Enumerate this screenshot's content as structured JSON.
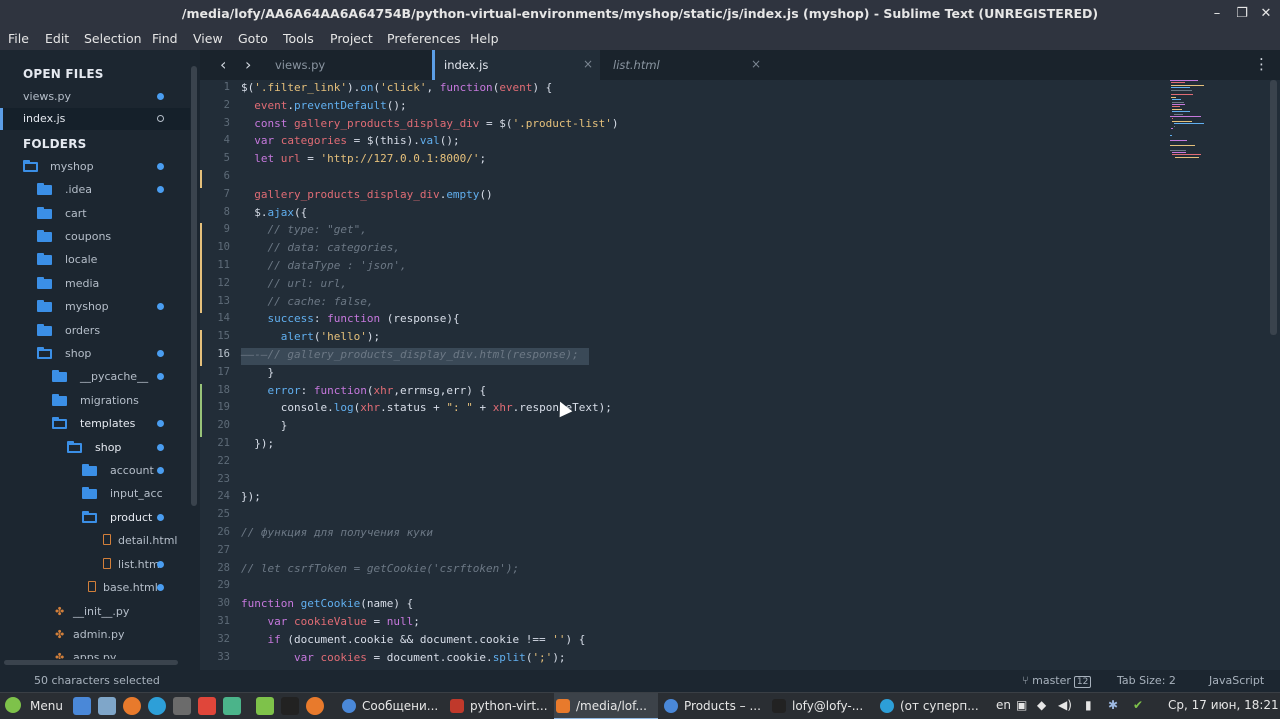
{
  "window": {
    "title": "/media/lofy/AA6A64AA6A64754B/python-virtual-environments/myshop/static/js/index.js (myshop) - Sublime Text (UNREGISTERED)",
    "minimize": "–",
    "maximize": "❐",
    "close": "✕"
  },
  "menu": [
    "File",
    "Edit",
    "Selection",
    "Find",
    "View",
    "Goto",
    "Tools",
    "Project",
    "Preferences",
    "Help"
  ],
  "sidebar": {
    "open_files_header": "OPEN FILES",
    "open_files": [
      "views.py",
      "index.js"
    ],
    "folders_header": "FOLDERS",
    "tree": [
      ".idea",
      "cart",
      "coupons",
      "locale",
      "media",
      "myshop",
      "orders",
      "shop",
      "__pycache__",
      "migrations",
      "templates",
      "shop",
      "account",
      "input_acc",
      "product",
      "detail.html",
      "list.htm",
      "base.html",
      "__init__.py",
      "admin.py",
      "apps.py"
    ],
    "root": "myshop"
  },
  "tabs": [
    {
      "label": "views.py"
    },
    {
      "label": "index.js"
    },
    {
      "label": "list.html"
    }
  ],
  "tab_close": "×",
  "nav": {
    "back": "‹",
    "forward": "›",
    "more": "⋮"
  },
  "code": {
    "line_numbers": [
      "1",
      "2",
      "3",
      "4",
      "5",
      "6",
      "7",
      "8",
      "9",
      "10",
      "11",
      "12",
      "13",
      "14",
      "15",
      "16",
      "17",
      "18",
      "19",
      "20",
      "21",
      "22",
      "23",
      "24",
      "25",
      "26",
      "27",
      "28",
      "29",
      "30",
      "31",
      "32",
      "33"
    ],
    "lines": [
      "$('.filter_link').on('click', function(event) {",
      "  event.preventDefault();",
      "  const gallery_products_display_div = $('.product-list')",
      "  var categories = $(this).val();",
      "  let url = 'http://127.0.0.1:8000/';",
      "",
      "  gallery_products_display_div.empty()",
      "  $.ajax({",
      "    // type: \"get\",",
      "    // data: categories,",
      "    // dataType : 'json',",
      "    // url: url,",
      "    // cache: false,",
      "    success: function (response){",
      "      alert('hello');",
      "——-—// gallery_products_display_div.html(response);",
      "    }",
      "    error: function(xhr,errmsg,err) {",
      "      console.log(xhr.status + \": \" + xhr.responseText);",
      "      }",
      "  });",
      "",
      "",
      "});",
      "",
      "// функция для получения куки",
      "",
      "// let csrfToken = getCookie('csrftoken');",
      "",
      "function getCookie(name) {",
      "    var cookieValue = null;",
      "    if (document.cookie && document.cookie !== '') {",
      "        var cookies = document.cookie.split(';');"
    ]
  },
  "status": {
    "selection": "50 characters selected",
    "branch": "master",
    "branch_count": "12",
    "tab_size": "Tab Size: 2",
    "syntax": "JavaScript"
  },
  "taskbar": {
    "menu": "Menu",
    "windows": [
      "Сообщени...",
      "python-virt...",
      "/media/lof...",
      "Products – ...",
      "lofy@lofy-...",
      "(от суперп..."
    ],
    "lang": "en",
    "clock": "Ср, 17 июн, 18:21"
  },
  "colors": {
    "accent": "#5c9ee6",
    "folder": "#3b8fe6",
    "editor_bg": "#222d38",
    "sidebar_bg": "#1c2630"
  }
}
